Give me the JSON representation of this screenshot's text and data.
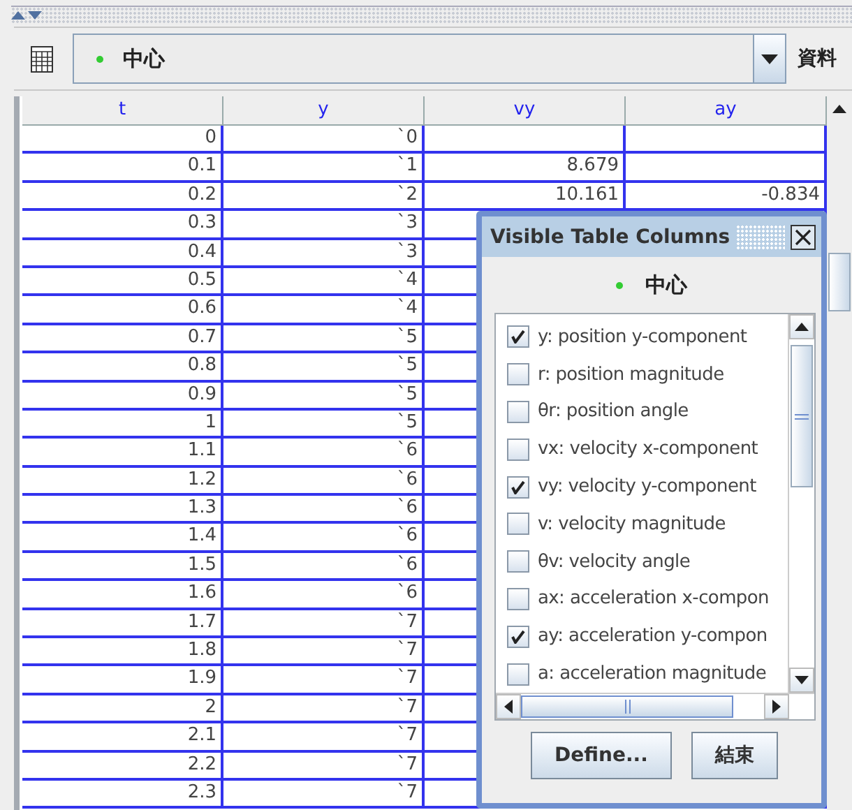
{
  "toolbar": {
    "selection": "中心",
    "label": "資料"
  },
  "table": {
    "columns": [
      "t",
      "y",
      "vy",
      "ay"
    ],
    "rows": [
      {
        "cells": [
          "0",
          "`0"
        ]
      },
      {
        "cells": [
          "0.1",
          "`1",
          "8.679"
        ]
      },
      {
        "cells": [
          "0.2",
          "`2",
          "10.161",
          "-0.834"
        ]
      },
      {
        "cells": [
          "0.3",
          "`3"
        ]
      },
      {
        "cells": [
          "0.4",
          "`3"
        ]
      },
      {
        "cells": [
          "0.5",
          "`4"
        ]
      },
      {
        "cells": [
          "0.6",
          "`4"
        ]
      },
      {
        "cells": [
          "0.7",
          "`5"
        ]
      },
      {
        "cells": [
          "0.8",
          "`5"
        ]
      },
      {
        "cells": [
          "0.9",
          "`5"
        ]
      },
      {
        "cells": [
          "1",
          "`5"
        ]
      },
      {
        "cells": [
          "1.1",
          "`6"
        ]
      },
      {
        "cells": [
          "1.2",
          "`6"
        ]
      },
      {
        "cells": [
          "1.3",
          "`6"
        ]
      },
      {
        "cells": [
          "1.4",
          "`6"
        ]
      },
      {
        "cells": [
          "1.5",
          "`6"
        ]
      },
      {
        "cells": [
          "1.6",
          "`6"
        ]
      },
      {
        "cells": [
          "1.7",
          "`7"
        ]
      },
      {
        "cells": [
          "1.8",
          "`7"
        ]
      },
      {
        "cells": [
          "1.9",
          "`7"
        ]
      },
      {
        "cells": [
          "2",
          "`7"
        ]
      },
      {
        "cells": [
          "2.1",
          "`7"
        ]
      },
      {
        "cells": [
          "2.2",
          "`7"
        ]
      },
      {
        "cells": [
          "2.3",
          "`7"
        ]
      }
    ]
  },
  "dialog": {
    "title": "Visible Table Columns",
    "selection": "中心",
    "items": [
      {
        "label": "y: position y-component",
        "checked": true
      },
      {
        "label": "r: position magnitude",
        "checked": false
      },
      {
        "label": "θr: position angle",
        "checked": false
      },
      {
        "label": "vx: velocity x-component",
        "checked": false
      },
      {
        "label": "vy: velocity y-component",
        "checked": true
      },
      {
        "label": "v: velocity magnitude",
        "checked": false
      },
      {
        "label": "θv: velocity angle",
        "checked": false
      },
      {
        "label": "ax: acceleration x-compon",
        "checked": false
      },
      {
        "label": "ay: acceleration y-compon",
        "checked": true
      },
      {
        "label": "a: acceleration magnitude",
        "checked": false
      }
    ],
    "buttons": [
      "Define...",
      "結束"
    ]
  }
}
